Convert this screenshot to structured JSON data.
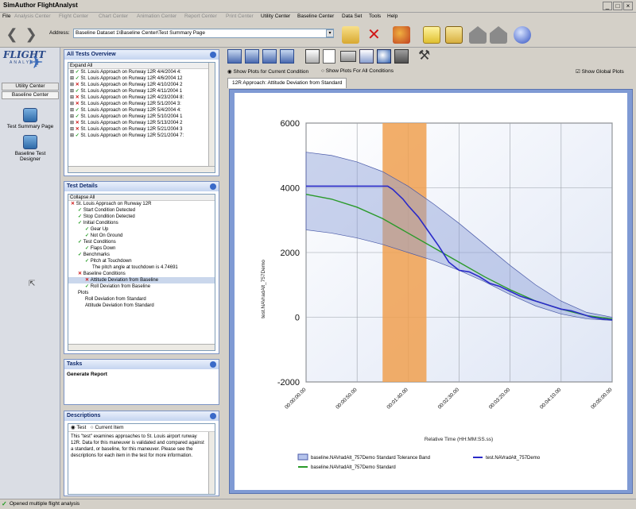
{
  "app": {
    "title": "SimAuthor FlightAnalyst"
  },
  "menu": [
    "File",
    "Analysis Center",
    "Flight Center",
    "Chart Center",
    "Animation Center",
    "Report Center",
    "Print Center",
    "Utility Center",
    "Baseline Center",
    "Data Set",
    "Tools",
    "Help"
  ],
  "toolbar": {
    "address_label": "Address:",
    "address_value": "Baseline Dataset 1\\Baseline Center\\Test Summary Page"
  },
  "leftnav": {
    "logo": "FLIGHT",
    "logo_sub": "ANALYST",
    "tabs": [
      "Utility Center",
      "Baseline Center"
    ],
    "items": [
      "Test Summary Page",
      "Baseline Test Designer"
    ]
  },
  "all_tests": {
    "title": "All Tests Overview",
    "expand_label": "Expand All",
    "rows": [
      {
        "status": "check",
        "text": "St. Louis Approach on Runway 12R 4/4/2004 4:"
      },
      {
        "status": "check",
        "text": "St. Louis Approach on Runway 12R 4/6/2004 12"
      },
      {
        "status": "x",
        "text": "St. Louis Approach on Runway 12R 4/10/2004 2"
      },
      {
        "status": "check",
        "text": "St. Louis Approach on Runway 12R 4/11/2004 1"
      },
      {
        "status": "x",
        "text": "St. Louis Approach on Runway 12R 4/23/2004 8:"
      },
      {
        "status": "x",
        "text": "St. Louis Approach on Runway 12R 5/1/2004 3:"
      },
      {
        "status": "check",
        "text": "St. Louis Approach on Runway 12R 5/4/2004 4:"
      },
      {
        "status": "check",
        "text": "St. Louis Approach on Runway 12R 5/10/2004 1"
      },
      {
        "status": "x",
        "text": "St. Louis Approach on Runway 12R 5/13/2004 2"
      },
      {
        "status": "x",
        "text": "St. Louis Approach on Runway 12R 5/21/2004 3"
      },
      {
        "status": "check",
        "text": "St. Louis Approach on Runway 12R 5/21/2004 7:"
      }
    ]
  },
  "test_details": {
    "title": "Test Details",
    "collapse_label": "Collapse All",
    "rows": [
      {
        "indent": 0,
        "status": "x",
        "text": "St. Louis Approach on Runway 12R"
      },
      {
        "indent": 1,
        "status": "check",
        "text": "Start Condition Detected"
      },
      {
        "indent": 1,
        "status": "check",
        "text": "Stop Condition Detected"
      },
      {
        "indent": 1,
        "status": "check",
        "text": "Initial Conditions"
      },
      {
        "indent": 2,
        "status": "check",
        "text": "Gear Up"
      },
      {
        "indent": 2,
        "status": "check",
        "text": "Not On Ground"
      },
      {
        "indent": 1,
        "status": "check",
        "text": "Test Conditions"
      },
      {
        "indent": 2,
        "status": "check",
        "text": "Flaps Down"
      },
      {
        "indent": 1,
        "status": "check",
        "text": "Benchmarks"
      },
      {
        "indent": 2,
        "status": "check",
        "text": "Pitch at Touchdown"
      },
      {
        "indent": 3,
        "status": "none",
        "text": "The pitch angle at touchdown is 4.74691"
      },
      {
        "indent": 1,
        "status": "x",
        "text": "Baseline Conditions"
      },
      {
        "indent": 2,
        "status": "x",
        "text": "Attitude Deviation from Baseline"
      },
      {
        "indent": 2,
        "status": "check",
        "text": "Roll Deviation from Baseline"
      },
      {
        "indent": 1,
        "status": "none",
        "text": "Plots"
      },
      {
        "indent": 2,
        "status": "none",
        "text": "Roll Deviation from Standard"
      },
      {
        "indent": 2,
        "status": "none",
        "text": "Attitude Deviation from Standard"
      }
    ]
  },
  "tasks": {
    "title": "Tasks",
    "items": [
      "Generate Report"
    ]
  },
  "descriptions": {
    "title": "Descriptions",
    "radio_test": "Test",
    "radio_current": "Current Item",
    "text": "This \"test\" examines approaches to St. Louis airport runway 12R.  Data for this maneuver is validated and compared against a standard, or baseline, for this maneuver.  Please see the descriptions for each item in the test for more information."
  },
  "plot_options": {
    "current": "Show Plots for Current Condition",
    "all": "Show Plots For All Conditions",
    "global": "Show Global Plots"
  },
  "tab_label": "12R Approach: Attitude Deviation from Standard",
  "status_text": "Opened multiple flight analysis",
  "chart_data": {
    "type": "line",
    "title": "",
    "xlabel": "Relative Time (HH:MM:SS.ss)",
    "ylabel": "test.NAVradAlt_757Demo",
    "x_ticks": [
      "00:00:00.00",
      "00:00:50.00",
      "00:01:40.00",
      "00:02:30.00",
      "00:03:20.00",
      "00:04:10.00",
      "00:05:00.00"
    ],
    "x_range_seconds": [
      0,
      300
    ],
    "y_ticks": [
      6000,
      4000,
      2000,
      0,
      -2000
    ],
    "ylim": [
      -2000,
      6000
    ],
    "highlight_band_seconds": [
      75,
      118
    ],
    "series": [
      {
        "name": "test.NAVradAlt_757Demo",
        "color": "#2a2ac8",
        "x": [
          0,
          20,
          40,
          60,
          80,
          85,
          90,
          95,
          100,
          110,
          120,
          130,
          140,
          150,
          160,
          170,
          180,
          190,
          200,
          210,
          220,
          230,
          240,
          250,
          260,
          270,
          280,
          290,
          300
        ],
        "y": [
          4050,
          4050,
          4050,
          4050,
          4050,
          3950,
          3800,
          3650,
          3450,
          3100,
          2650,
          2200,
          1700,
          1450,
          1400,
          1250,
          1050,
          950,
          800,
          650,
          550,
          450,
          350,
          250,
          200,
          100,
          0,
          -50,
          -80
        ]
      },
      {
        "name": "baseline.NAVradAlt_757Demo Standard",
        "color": "#2a9a2a",
        "x": [
          0,
          25,
          50,
          75,
          100,
          125,
          150,
          175,
          200,
          225,
          250,
          275,
          300
        ],
        "y": [
          3800,
          3650,
          3400,
          3050,
          2600,
          2150,
          1700,
          1250,
          850,
          500,
          250,
          50,
          -50
        ]
      },
      {
        "name": "baseline.NAVradAlt_757Demo Standard Tolerance Band",
        "color": "#8a9ed6",
        "x": [
          0,
          25,
          50,
          75,
          100,
          125,
          150,
          175,
          200,
          225,
          250,
          275,
          300
        ],
        "upper": [
          5100,
          5000,
          4800,
          4500,
          4050,
          3500,
          2900,
          2250,
          1600,
          1000,
          500,
          150,
          0
        ],
        "lower": [
          2700,
          2600,
          2450,
          2250,
          2000,
          1750,
          1450,
          1100,
          700,
          350,
          100,
          -50,
          -100
        ]
      }
    ]
  }
}
